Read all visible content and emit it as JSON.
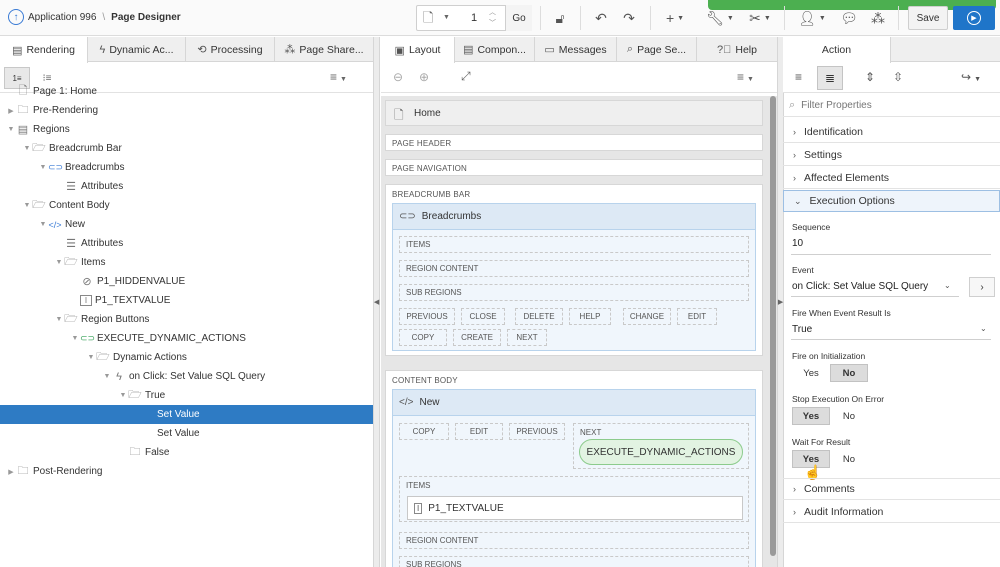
{
  "toolbar": {
    "app_label": "Application 996",
    "separator": "\\",
    "page_designer_label": "Page Designer",
    "page_number": "1",
    "go_label": "Go",
    "save_label": "Save"
  },
  "left": {
    "tabs": [
      {
        "label": "Rendering"
      },
      {
        "label": "Dynamic Ac..."
      },
      {
        "label": "Processing"
      },
      {
        "label": "Page Share..."
      }
    ],
    "tree": [
      {
        "label": "Page 1: Home",
        "level": 0,
        "twisty": "",
        "icon": "page"
      },
      {
        "label": "Pre-Rendering",
        "level": 0,
        "twisty": "▶",
        "icon": "folder"
      },
      {
        "label": "Regions",
        "level": 0,
        "twisty": "▼",
        "icon": "regions"
      },
      {
        "label": "Breadcrumb Bar",
        "level": 1,
        "twisty": "▼",
        "icon": "folder-open"
      },
      {
        "label": "Breadcrumbs",
        "level": 2,
        "twisty": "▼",
        "icon": "breadcrumb"
      },
      {
        "label": "Attributes",
        "level": 3,
        "twisty": "",
        "icon": "list"
      },
      {
        "label": "Content Body",
        "level": 1,
        "twisty": "▼",
        "icon": "folder-open"
      },
      {
        "label": "New",
        "level": 2,
        "twisty": "▼",
        "icon": "code"
      },
      {
        "label": "Attributes",
        "level": 3,
        "twisty": "",
        "icon": "list"
      },
      {
        "label": "Items",
        "level": 3,
        "twisty": "▼",
        "icon": "folder-open"
      },
      {
        "label": "P1_HIDDENVALUE",
        "level": 4,
        "twisty": "",
        "icon": "hidden"
      },
      {
        "label": "P1_TEXTVALUE",
        "level": 4,
        "twisty": "",
        "icon": "textfield"
      },
      {
        "label": "Region Buttons",
        "level": 3,
        "twisty": "▼",
        "icon": "folder-open"
      },
      {
        "label": "EXECUTE_DYNAMIC_ACTIONS",
        "level": 4,
        "twisty": "▼",
        "icon": "button"
      },
      {
        "label": "Dynamic Actions",
        "level": 5,
        "twisty": "▼",
        "icon": "folder-open"
      },
      {
        "label": "on Click: Set Value SQL Query",
        "level": 6,
        "twisty": "▼",
        "icon": "bolt"
      },
      {
        "label": "True",
        "level": 7,
        "twisty": "▼",
        "icon": "folder-open"
      },
      {
        "label": "Set Value",
        "level": 8,
        "twisty": "",
        "icon": "",
        "selected": true
      },
      {
        "label": "Set Value",
        "level": 8,
        "twisty": "",
        "icon": ""
      },
      {
        "label": "False",
        "level": 7,
        "twisty": "",
        "icon": "folder"
      },
      {
        "label": "Post-Rendering",
        "level": 0,
        "twisty": "▶",
        "icon": "folder"
      }
    ]
  },
  "middle": {
    "tabs": [
      {
        "label": "Layout"
      },
      {
        "label": "Compon..."
      },
      {
        "label": "Messages"
      },
      {
        "label": "Page Se..."
      },
      {
        "label": "Help"
      }
    ],
    "home_label": "Home",
    "page_header": "PAGE HEADER",
    "page_navigation": "PAGE NAVIGATION",
    "breadcrumb_bar": "BREADCRUMB BAR",
    "breadcrumbs_region": "Breadcrumbs",
    "bc_items": "ITEMS",
    "bc_region_content": "REGION CONTENT",
    "bc_sub_regions": "SUB REGIONS",
    "bc_positions_row1": [
      "PREVIOUS",
      "CLOSE",
      "DELETE",
      "HELP",
      "CHANGE",
      "EDIT"
    ],
    "bc_positions_row2": [
      "COPY",
      "CREATE",
      "NEXT"
    ],
    "content_body": "CONTENT BODY",
    "new_region": "New",
    "new_positions": [
      "COPY",
      "EDIT",
      "PREVIOUS",
      "NEXT"
    ],
    "execute_button": "EXECUTE_DYNAMIC_ACTIONS",
    "new_items": "ITEMS",
    "textvalue_item": "P1_TEXTVALUE",
    "new_region_content": "REGION CONTENT",
    "new_sub_regions": "SUB REGIONS"
  },
  "right": {
    "tab_label": "Action",
    "filter_placeholder": "Filter Properties",
    "groups_top": [
      {
        "label": "Identification",
        "open": false
      },
      {
        "label": "Settings",
        "open": false
      },
      {
        "label": "Affected Elements",
        "open": false
      },
      {
        "label": "Execution Options",
        "open": true
      }
    ],
    "sequence_label": "Sequence",
    "sequence_value": "10",
    "event_label": "Event",
    "event_value": "on Click: Set Value SQL Query",
    "fire_when_label": "Fire When Event Result Is",
    "fire_when_value": "True",
    "fire_init_label": "Fire on Initialization",
    "fire_init_yes": "Yes",
    "fire_init_no": "No",
    "stop_exec_label": "Stop Execution On Error",
    "stop_exec_yes": "Yes",
    "stop_exec_no": "No",
    "wait_label": "Wait For Result",
    "wait_yes": "Yes",
    "wait_no": "No",
    "groups_bottom": [
      {
        "label": "Comments"
      },
      {
        "label": "Audit Information"
      }
    ]
  },
  "colors": {
    "selection": "#2e7bc4",
    "run_button": "#1f75c9",
    "green_strip": "#4caf50"
  }
}
